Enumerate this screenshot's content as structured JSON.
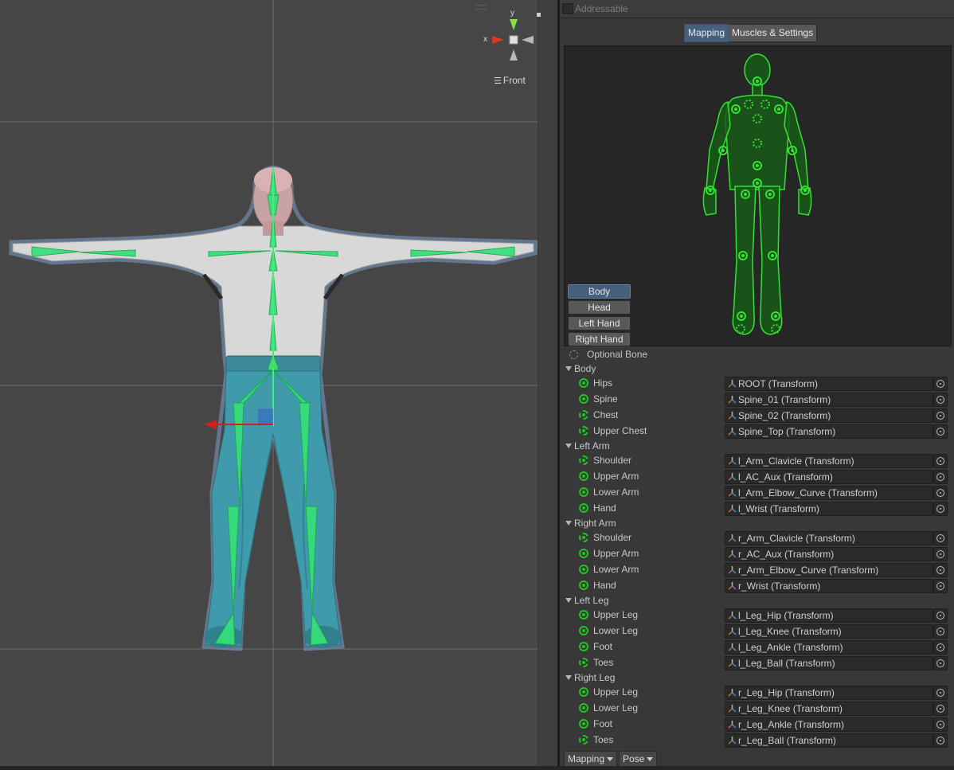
{
  "scene": {
    "view_label": "Front",
    "axis_labels": {
      "x": "x",
      "y": "y"
    }
  },
  "inspector": {
    "addressable_label": "Addressable",
    "addressable_checked": false,
    "tabs": [
      {
        "label": "Mapping",
        "active": true
      },
      {
        "label": "Muscles & Settings",
        "active": false
      }
    ],
    "body_parts": [
      {
        "label": "Body",
        "active": true
      },
      {
        "label": "Head",
        "active": false
      },
      {
        "label": "Left Hand",
        "active": false
      },
      {
        "label": "Right Hand",
        "active": false
      }
    ],
    "legend_label": "Optional Bone",
    "groups": [
      {
        "label": "Body",
        "bones": [
          {
            "name": "Hips",
            "value": "ROOT (Transform)",
            "optional": false
          },
          {
            "name": "Spine",
            "value": "Spine_01 (Transform)",
            "optional": false
          },
          {
            "name": "Chest",
            "value": "Spine_02 (Transform)",
            "optional": true
          },
          {
            "name": "Upper Chest",
            "value": "Spine_Top (Transform)",
            "optional": true
          }
        ]
      },
      {
        "label": "Left Arm",
        "bones": [
          {
            "name": "Shoulder",
            "value": "l_Arm_Clavicle (Transform)",
            "optional": true
          },
          {
            "name": "Upper Arm",
            "value": "l_AC_Aux (Transform)",
            "optional": false
          },
          {
            "name": "Lower Arm",
            "value": "l_Arm_Elbow_Curve (Transform)",
            "optional": false
          },
          {
            "name": "Hand",
            "value": "l_Wrist (Transform)",
            "optional": false
          }
        ]
      },
      {
        "label": "Right Arm",
        "bones": [
          {
            "name": "Shoulder",
            "value": "r_Arm_Clavicle (Transform)",
            "optional": true
          },
          {
            "name": "Upper Arm",
            "value": "r_AC_Aux (Transform)",
            "optional": false
          },
          {
            "name": "Lower Arm",
            "value": "r_Arm_Elbow_Curve (Transform)",
            "optional": false
          },
          {
            "name": "Hand",
            "value": "r_Wrist (Transform)",
            "optional": false
          }
        ]
      },
      {
        "label": "Left Leg",
        "bones": [
          {
            "name": "Upper Leg",
            "value": "l_Leg_Hip (Transform)",
            "optional": false
          },
          {
            "name": "Lower Leg",
            "value": "l_Leg_Knee (Transform)",
            "optional": false
          },
          {
            "name": "Foot",
            "value": "l_Leg_Ankle (Transform)",
            "optional": false
          },
          {
            "name": "Toes",
            "value": "l_Leg_Ball (Transform)",
            "optional": true
          }
        ]
      },
      {
        "label": "Right Leg",
        "bones": [
          {
            "name": "Upper Leg",
            "value": "r_Leg_Hip (Transform)",
            "optional": false
          },
          {
            "name": "Lower Leg",
            "value": "r_Leg_Knee (Transform)",
            "optional": false
          },
          {
            "name": "Foot",
            "value": "r_Leg_Ankle (Transform)",
            "optional": false
          },
          {
            "name": "Toes",
            "value": "r_Leg_Ball (Transform)",
            "optional": true
          }
        ]
      }
    ],
    "bottom_buttons": [
      {
        "label": "Mapping",
        "icon": "chevron-down-icon"
      },
      {
        "label": "Pose",
        "icon": "chevron-down-icon"
      }
    ],
    "colors": {
      "bone_green": "#21c321",
      "active_tab": "#46607c",
      "mesh_teal": "#3f9bab"
    }
  }
}
